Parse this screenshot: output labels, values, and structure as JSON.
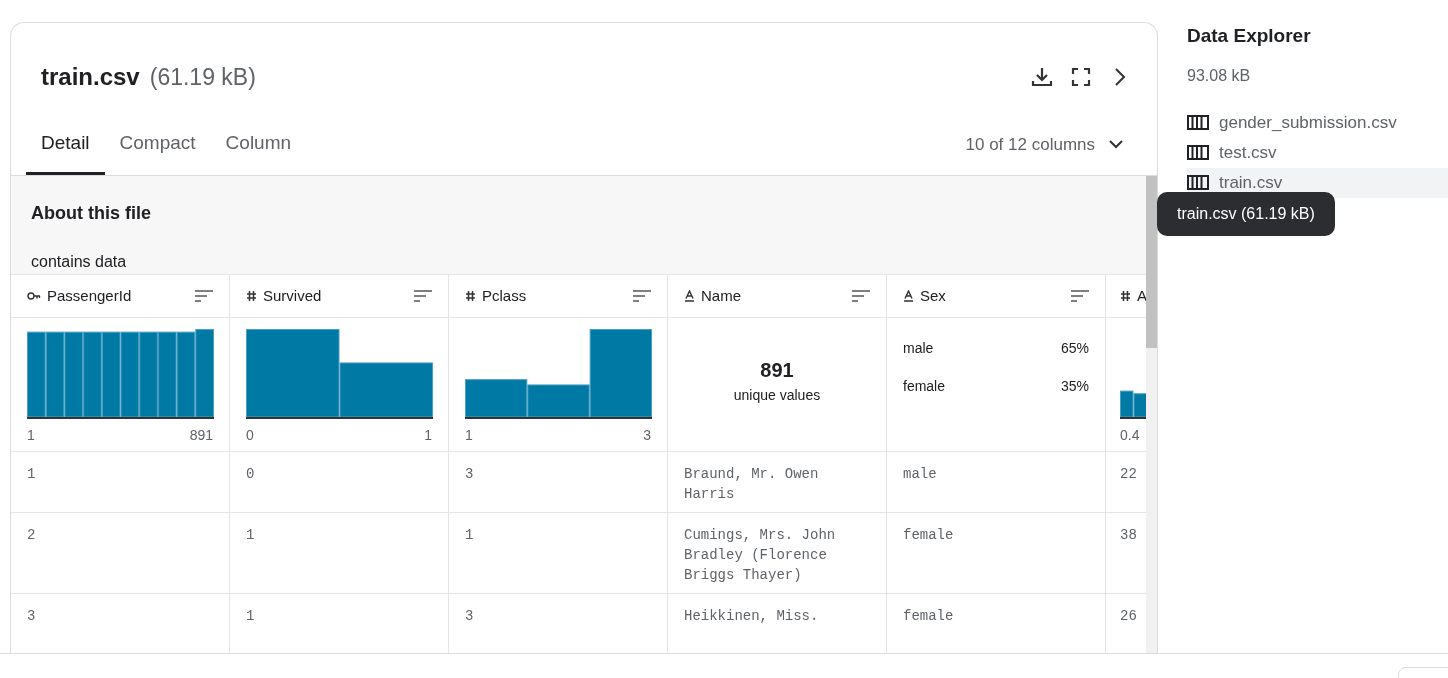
{
  "file": {
    "name": "train.csv",
    "size": "(61.19 kB)"
  },
  "tabs": [
    {
      "label": "Detail",
      "selected": true
    },
    {
      "label": "Compact",
      "selected": false
    },
    {
      "label": "Column",
      "selected": false
    }
  ],
  "column_picker": "10 of 12 columns",
  "about": {
    "title": "About this file",
    "text": "contains data"
  },
  "columns": [
    {
      "kind": "key",
      "name": "PassengerId",
      "cut": false,
      "summary": {
        "kind": "histogram",
        "min": "1",
        "max": "891"
      }
    },
    {
      "kind": "number",
      "name": "Survived",
      "cut": false,
      "summary": {
        "kind": "histogram",
        "min": "0",
        "max": "1"
      }
    },
    {
      "kind": "number",
      "name": "Pclass",
      "cut": false,
      "summary": {
        "kind": "histogram",
        "min": "1",
        "max": "3"
      }
    },
    {
      "kind": "string",
      "name": "Name",
      "cut": false,
      "summary": {
        "kind": "unique",
        "count": "891",
        "label": "unique values"
      }
    },
    {
      "kind": "string",
      "name": "Sex",
      "cut": false,
      "summary": {
        "kind": "categories",
        "items": [
          {
            "label": "male",
            "share": "65%"
          },
          {
            "label": "female",
            "share": "35%"
          }
        ]
      }
    },
    {
      "kind": "number",
      "name": "A",
      "cut": true,
      "summary": {
        "kind": "histogram",
        "min": "0.4"
      }
    }
  ],
  "rows": [
    [
      "1",
      "0",
      "3",
      "Braund, Mr. Owen Harris",
      "male",
      "22"
    ],
    [
      "2",
      "1",
      "1",
      "Cumings, Mrs. John Bradley (Florence Briggs Thayer)",
      "female",
      "38"
    ],
    [
      "3",
      "1",
      "3",
      "Heikkinen, Miss.",
      "female",
      "26"
    ]
  ],
  "explorer": {
    "title": "Data Explorer",
    "size": "93.08 kB",
    "files": [
      {
        "name": "gender_submission.csv",
        "selected": false
      },
      {
        "name": "test.csv",
        "selected": false
      },
      {
        "name": "train.csv",
        "selected": true
      }
    ]
  },
  "tooltip": "train.csv (61.19 kB)"
}
